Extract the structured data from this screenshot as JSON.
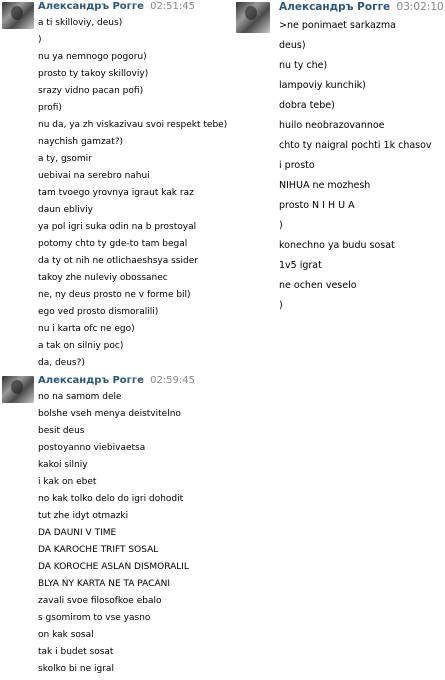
{
  "colors": {
    "author": "#2b587a",
    "time": "#888888"
  },
  "messages_left": [
    {
      "author": "Александръ Рогге",
      "time": "02:51:45",
      "lines": [
        "a ti skilloviy, deus)",
        ")",
        "nu ya nemnogo pogoru)",
        "prosto ty takoy skilloviy)",
        "srazy vidno pacan pofi)",
        "profi)",
        "nu da, ya zh viskazivau svoi respekt tebe)",
        "naychish gamzat?)",
        "a ty, gsomir",
        "uebivai na serebro nahui",
        "tam tvoego yrovnya igraut kak raz",
        "daun ebliviy",
        "ya pol igri suka odin na b prostoyal",
        "potomy chto ty gde-to tam begal",
        "da ty ot nih ne otlichaeshsya ssider",
        "takoy zhe nuleviy obossanec",
        "ne, ny deus prosto ne v forme bil)",
        "ego ved prosto dismoralili)",
        "nu i karta ofc ne ego)",
        "a tak on silniy poc)",
        "da, deus?)"
      ]
    },
    {
      "author": "Александръ Рогге",
      "time": "02:59:45",
      "lines": [
        "no na samom dele",
        "bolshe vseh menya deistvitelno",
        "besit deus",
        "postoyanno viebivaetsa",
        "kakoi silniy",
        "i kak on ebet",
        "no kak tolko delo do igri dohodit",
        "tut zhe idyt otmazki",
        "DA DAUNI V TIME",
        "DA KAROCHE TRIFT SOSAL",
        "DA KOROCHE ASLAN DISMORALIL",
        "BLYA NY KARTA NE TA PACANI",
        "zavali svoe filosofkoe ebalo",
        "s gsomirom to vse yasno",
        "on kak sosal",
        "tak i budet sosat",
        "skolko bi ne igral"
      ]
    }
  ],
  "messages_right": [
    {
      "author": "Александръ Рогге",
      "time": "03:02:10",
      "lines": [
        ">ne ponimaet sarkazma",
        "deus)",
        "nu ty che)",
        "lampoviy kunchik)",
        "dobra tebe)",
        "huilo neobrazovannoe",
        "chto ty naigral pochti 1k chasov",
        "i prosto",
        "NIHUA ne mozhesh",
        "prosto N I H U A",
        ")",
        "konechno ya budu sosat",
        "1v5 igrat",
        "ne ochen veselo",
        ")"
      ]
    }
  ]
}
